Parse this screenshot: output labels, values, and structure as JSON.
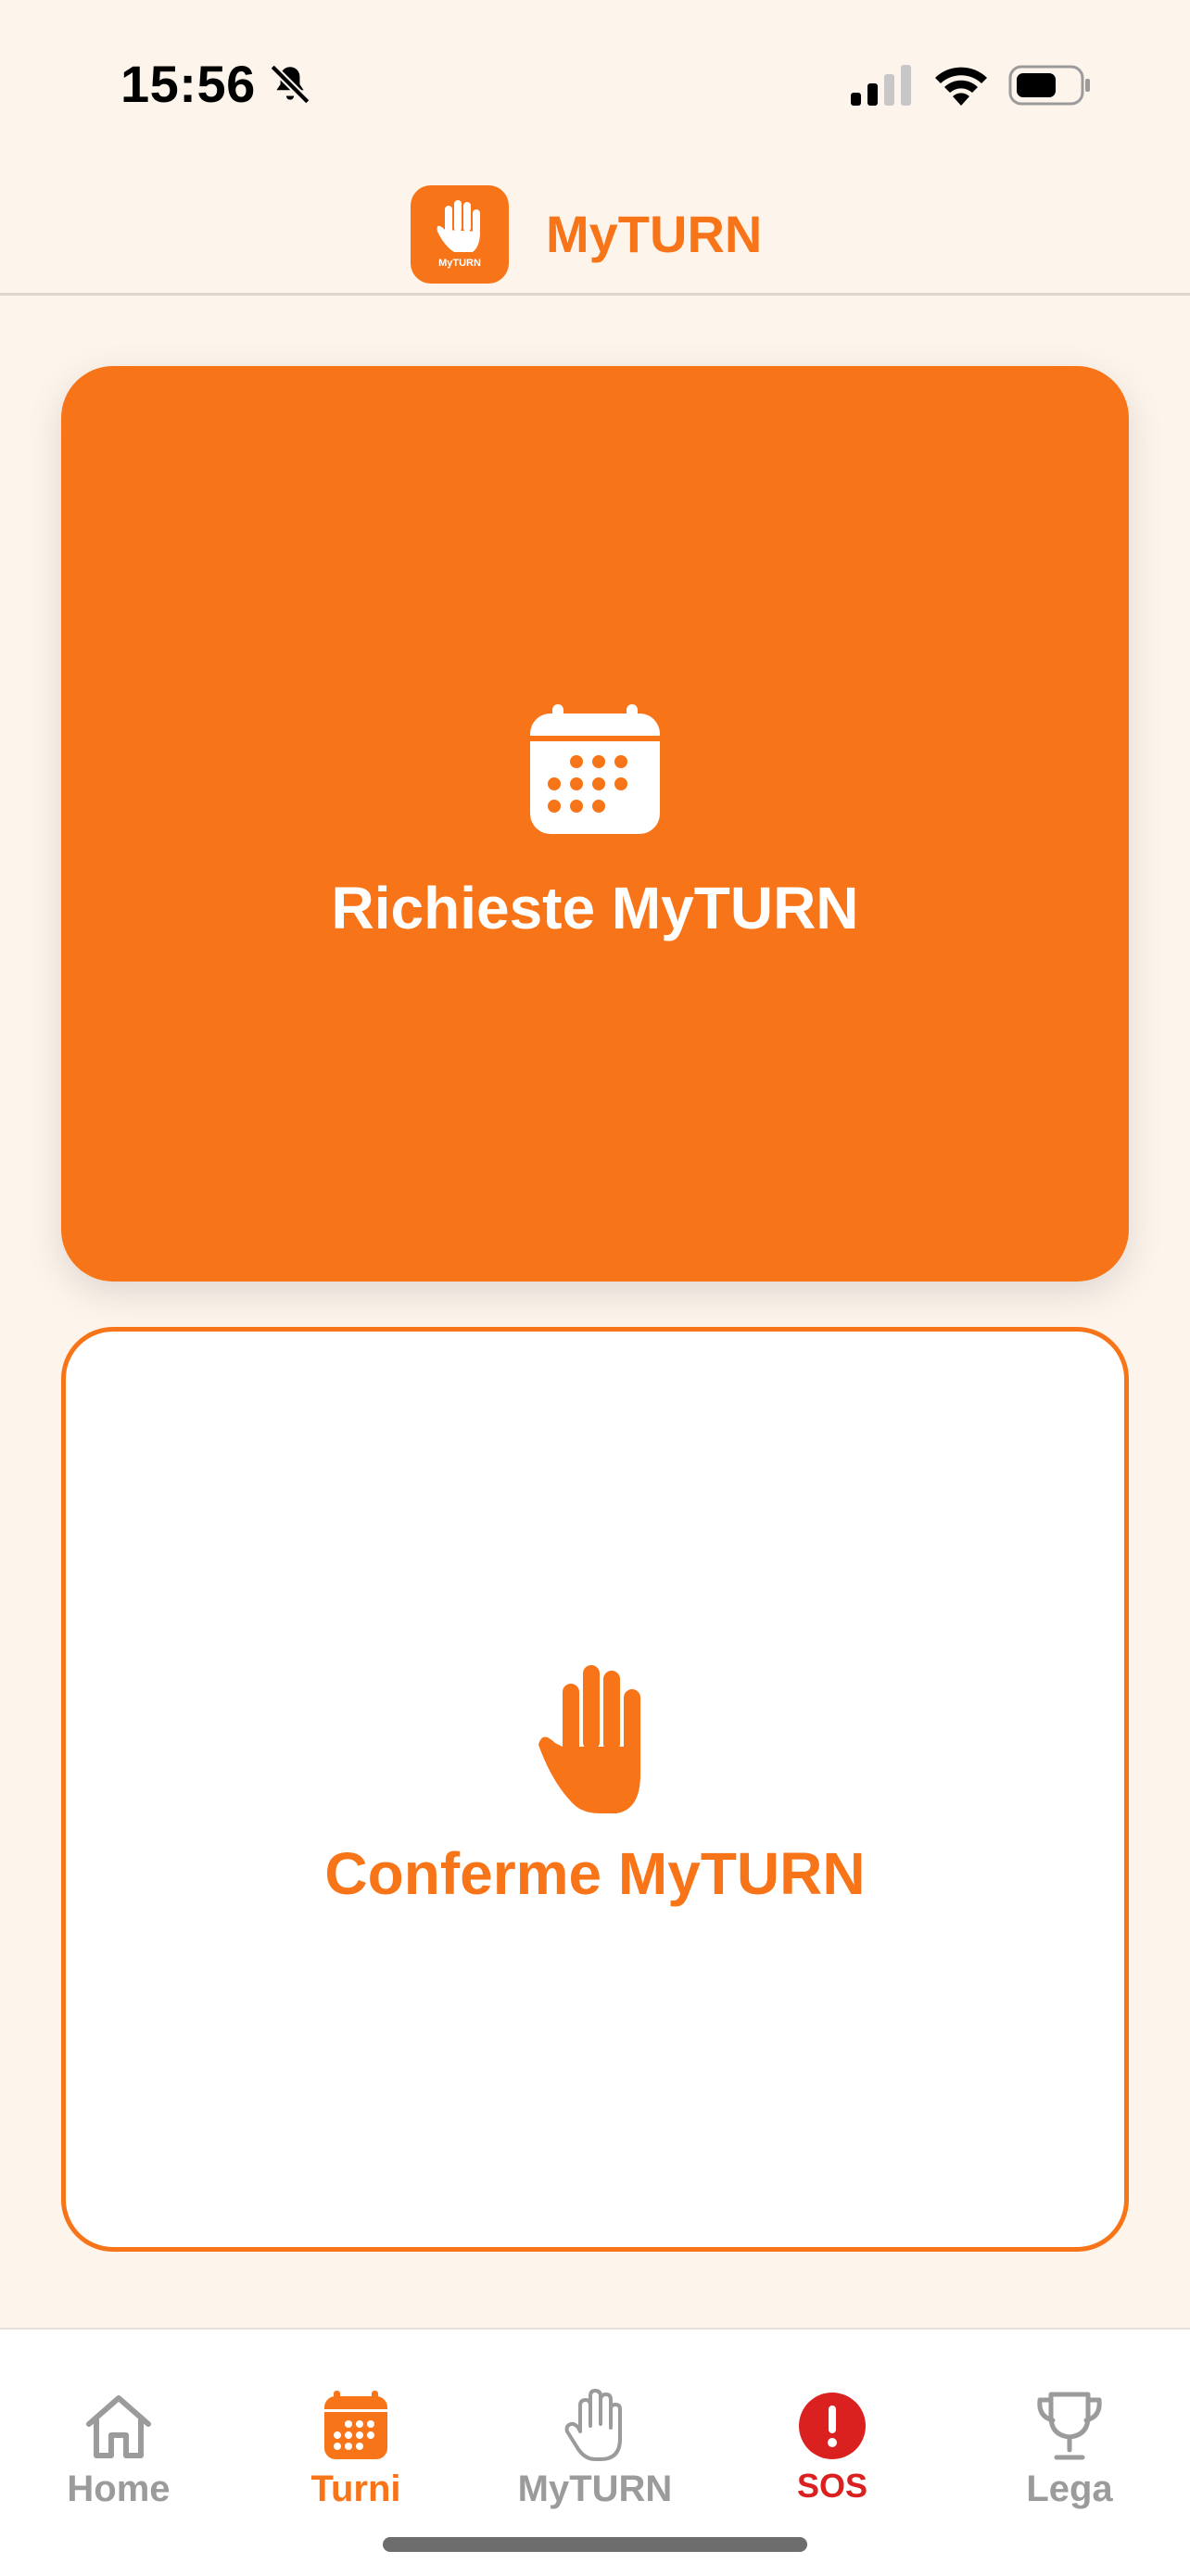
{
  "status_bar": {
    "time": "15:56",
    "icons": [
      "bell-muted-icon",
      "cellular-signal-icon",
      "wifi-icon",
      "battery-icon"
    ]
  },
  "header": {
    "logo_text": "MyTURN",
    "title": "MyTURN",
    "brand_color": "#F77518"
  },
  "cards": [
    {
      "label": "Richieste MyTURN",
      "icon": "calendar-icon",
      "style": "filled"
    },
    {
      "label": "Conferme MyTURN",
      "icon": "hand-icon",
      "style": "outlined"
    }
  ],
  "tab_bar": {
    "tabs": [
      {
        "label": "Home",
        "icon": "home-icon",
        "active": false
      },
      {
        "label": "Turni",
        "icon": "calendar-icon",
        "active": true
      },
      {
        "label": "MyTURN",
        "icon": "hand-icon",
        "active": false
      },
      {
        "label": "SOS",
        "icon": "alert-icon",
        "active": false
      },
      {
        "label": "Lega",
        "icon": "trophy-icon",
        "active": false
      }
    ],
    "inactive_color": "#9B9B9B",
    "sos_color": "#DB2020"
  }
}
